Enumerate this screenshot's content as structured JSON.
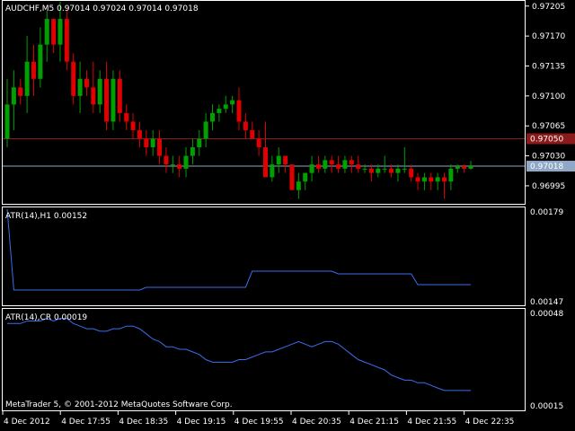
{
  "app": {
    "copyright": "MetaTrader 5, © 2001-2012 MetaQuotes Software Corp.",
    "colors": {
      "background": "#000000",
      "frame": "#ffffff",
      "bull_candle": "#00a000",
      "bear_candle": "#e00000",
      "indicator_line": "#3b6df0",
      "bid_line": "#8fa8c8",
      "ask_line": "#8b1a1a",
      "ask_label_bg": "#8b1a1a",
      "bid_label_bg": "#8fa8c8"
    }
  },
  "main_pane": {
    "header": "AUDCHF,M5  0.97014 0.97024 0.97014 0.97018",
    "price_ticks": [
      "0.97205",
      "0.97170",
      "0.97135",
      "0.97100",
      "0.97065",
      "0.97030",
      "0.96995"
    ],
    "ask_label": "0.97050",
    "bid_label": "0.97018"
  },
  "atr_h1_pane": {
    "header": "ATR(14),H1  0.00152",
    "ticks": [
      "0.00179",
      "0.00147"
    ]
  },
  "atr_cr_pane": {
    "header": "ATR(14),CR  0.00019",
    "ticks": [
      "0.00048",
      "0.00015"
    ]
  },
  "time_axis": {
    "labels": [
      "4 Dec 2012",
      "4 Dec 17:55",
      "4 Dec 18:35",
      "4 Dec 19:15",
      "4 Dec 19:55",
      "4 Dec 20:35",
      "4 Dec 21:15",
      "4 Dec 21:55",
      "4 Dec 22:35"
    ]
  },
  "chart_data": [
    {
      "type": "candlestick",
      "symbol": "AUDCHF",
      "timeframe": "M5",
      "ylim": [
        0.96975,
        0.9721
      ],
      "ask_price": 0.9705,
      "bid_price": 0.97018,
      "candles": [
        [
          0.9705,
          0.9712,
          0.9704,
          0.9709
        ],
        [
          0.9709,
          0.9713,
          0.9706,
          0.9711
        ],
        [
          0.9711,
          0.9712,
          0.9709,
          0.971
        ],
        [
          0.971,
          0.9717,
          0.9708,
          0.9714
        ],
        [
          0.9714,
          0.9716,
          0.971,
          0.9712
        ],
        [
          0.9712,
          0.9718,
          0.9711,
          0.9716
        ],
        [
          0.9716,
          0.972,
          0.9714,
          0.9719
        ],
        [
          0.9719,
          0.9719,
          0.9715,
          0.9716
        ],
        [
          0.9716,
          0.9721,
          0.9714,
          0.9719
        ],
        [
          0.9719,
          0.972,
          0.9713,
          0.9714
        ],
        [
          0.9714,
          0.9715,
          0.9709,
          0.971
        ],
        [
          0.971,
          0.9714,
          0.9708,
          0.9712
        ],
        [
          0.9712,
          0.9713,
          0.971,
          0.9711
        ],
        [
          0.9711,
          0.9714,
          0.9708,
          0.9709
        ],
        [
          0.9709,
          0.9713,
          0.9708,
          0.9712
        ],
        [
          0.9712,
          0.9714,
          0.9706,
          0.9707
        ],
        [
          0.9707,
          0.9713,
          0.9706,
          0.9712
        ],
        [
          0.9712,
          0.9713,
          0.9707,
          0.9708
        ],
        [
          0.9708,
          0.9709,
          0.9706,
          0.9707
        ],
        [
          0.9707,
          0.9708,
          0.9705,
          0.9706
        ],
        [
          0.9706,
          0.9707,
          0.9704,
          0.9705
        ],
        [
          0.9705,
          0.9706,
          0.9703,
          0.9704
        ],
        [
          0.9704,
          0.9706,
          0.9703,
          0.9705
        ],
        [
          0.9705,
          0.9706,
          0.9702,
          0.9703
        ],
        [
          0.9703,
          0.9704,
          0.9701,
          0.9702
        ],
        [
          0.9702,
          0.9703,
          0.9701,
          0.9702
        ],
        [
          0.9702,
          0.9703,
          0.97005,
          0.97015
        ],
        [
          0.97015,
          0.9704,
          0.97005,
          0.9703
        ],
        [
          0.9703,
          0.9705,
          0.9702,
          0.9704
        ],
        [
          0.9704,
          0.9706,
          0.9703,
          0.9705
        ],
        [
          0.9705,
          0.9708,
          0.9704,
          0.9707
        ],
        [
          0.9707,
          0.9709,
          0.9706,
          0.9708
        ],
        [
          0.9708,
          0.9709,
          0.9707,
          0.97085
        ],
        [
          0.97085,
          0.971,
          0.9708,
          0.9709
        ],
        [
          0.9709,
          0.971,
          0.9708,
          0.97095
        ],
        [
          0.97095,
          0.9711,
          0.9706,
          0.9707
        ],
        [
          0.9707,
          0.9708,
          0.9705,
          0.9706
        ],
        [
          0.9706,
          0.9707,
          0.9705,
          0.9705
        ],
        [
          0.9705,
          0.9706,
          0.9703,
          0.9704
        ],
        [
          0.9704,
          0.9707,
          0.97005,
          0.97005
        ],
        [
          0.97005,
          0.9703,
          0.97,
          0.9702
        ],
        [
          0.9702,
          0.9704,
          0.9701,
          0.9703
        ],
        [
          0.9703,
          0.9703,
          0.9701,
          0.9702
        ],
        [
          0.9702,
          0.9702,
          0.9699,
          0.9699
        ],
        [
          0.9699,
          0.9701,
          0.9698,
          0.97
        ],
        [
          0.97,
          0.9701,
          0.9699,
          0.9701
        ],
        [
          0.9701,
          0.9703,
          0.97,
          0.9702
        ],
        [
          0.9702,
          0.9703,
          0.9701,
          0.97015
        ],
        [
          0.97015,
          0.9703,
          0.9701,
          0.97025
        ],
        [
          0.97025,
          0.9703,
          0.9701,
          0.9702
        ],
        [
          0.9702,
          0.9703,
          0.9701,
          0.97015
        ],
        [
          0.97015,
          0.9703,
          0.9701,
          0.97025
        ],
        [
          0.97025,
          0.9703,
          0.9701,
          0.9702
        ],
        [
          0.9702,
          0.9703,
          0.9701,
          0.97015
        ],
        [
          0.97015,
          0.9702,
          0.9701,
          0.97015
        ],
        [
          0.97015,
          0.9702,
          0.97,
          0.9701
        ],
        [
          0.9701,
          0.9702,
          0.97005,
          0.97015
        ],
        [
          0.97015,
          0.9703,
          0.9701,
          0.97015
        ],
        [
          0.97015,
          0.9702,
          0.97005,
          0.9701
        ],
        [
          0.9701,
          0.9702,
          0.97,
          0.97015
        ],
        [
          0.97015,
          0.9704,
          0.9701,
          0.97015
        ],
        [
          0.97015,
          0.9702,
          0.97,
          0.97005
        ],
        [
          0.97005,
          0.9701,
          0.9699,
          0.97
        ],
        [
          0.97,
          0.9701,
          0.9699,
          0.97005
        ],
        [
          0.97005,
          0.9701,
          0.9699,
          0.97
        ],
        [
          0.97,
          0.9701,
          0.9699,
          0.97005
        ],
        [
          0.97005,
          0.9701,
          0.9698,
          0.97
        ],
        [
          0.97,
          0.9702,
          0.9699,
          0.97015
        ],
        [
          0.97015,
          0.9702,
          0.9701,
          0.97018
        ],
        [
          0.97018,
          0.9702,
          0.9701,
          0.97015
        ],
        [
          0.97015,
          0.97024,
          0.97014,
          0.97018
        ]
      ]
    },
    {
      "type": "line",
      "name": "ATR(14),H1",
      "ylim": [
        0.00145,
        0.0018
      ],
      "values": [
        0.0018,
        0.0015,
        0.0015,
        0.0015,
        0.0015,
        0.0015,
        0.0015,
        0.0015,
        0.0015,
        0.0015,
        0.0015,
        0.0015,
        0.0015,
        0.0015,
        0.0015,
        0.0015,
        0.0015,
        0.0015,
        0.0015,
        0.0015,
        0.0015,
        0.00151,
        0.00151,
        0.00151,
        0.00151,
        0.00151,
        0.00151,
        0.00151,
        0.00151,
        0.00151,
        0.00151,
        0.00151,
        0.00151,
        0.00151,
        0.00151,
        0.00151,
        0.00151,
        0.00157,
        0.00157,
        0.00157,
        0.00157,
        0.00157,
        0.00157,
        0.00157,
        0.00157,
        0.00157,
        0.00157,
        0.00157,
        0.00157,
        0.00157,
        0.00156,
        0.00156,
        0.00156,
        0.00156,
        0.00156,
        0.00156,
        0.00156,
        0.00156,
        0.00156,
        0.00156,
        0.00156,
        0.00156,
        0.00152,
        0.00152,
        0.00152,
        0.00152,
        0.00152,
        0.00152,
        0.00152,
        0.00152,
        0.00152
      ]
    },
    {
      "type": "line",
      "name": "ATR(14),CR",
      "ylim": [
        0.00012,
        0.0005
      ],
      "values": [
        0.00045,
        0.00045,
        0.00045,
        0.00046,
        0.00046,
        0.00046,
        0.00047,
        0.00046,
        0.00047,
        0.00047,
        0.00045,
        0.00044,
        0.00043,
        0.00043,
        0.00042,
        0.00042,
        0.00043,
        0.00043,
        0.00044,
        0.00044,
        0.00043,
        0.00041,
        0.00039,
        0.00038,
        0.00036,
        0.00036,
        0.00035,
        0.00035,
        0.00034,
        0.00033,
        0.00031,
        0.0003,
        0.0003,
        0.0003,
        0.0003,
        0.00031,
        0.00031,
        0.00032,
        0.00033,
        0.00034,
        0.00034,
        0.00035,
        0.00036,
        0.00037,
        0.00038,
        0.00037,
        0.00036,
        0.00037,
        0.00038,
        0.00038,
        0.00037,
        0.00035,
        0.00033,
        0.00031,
        0.0003,
        0.00029,
        0.00028,
        0.00027,
        0.00025,
        0.00024,
        0.00023,
        0.00023,
        0.00022,
        0.00022,
        0.00021,
        0.0002,
        0.00019,
        0.00019,
        0.00019,
        0.00019,
        0.00019
      ]
    }
  ]
}
